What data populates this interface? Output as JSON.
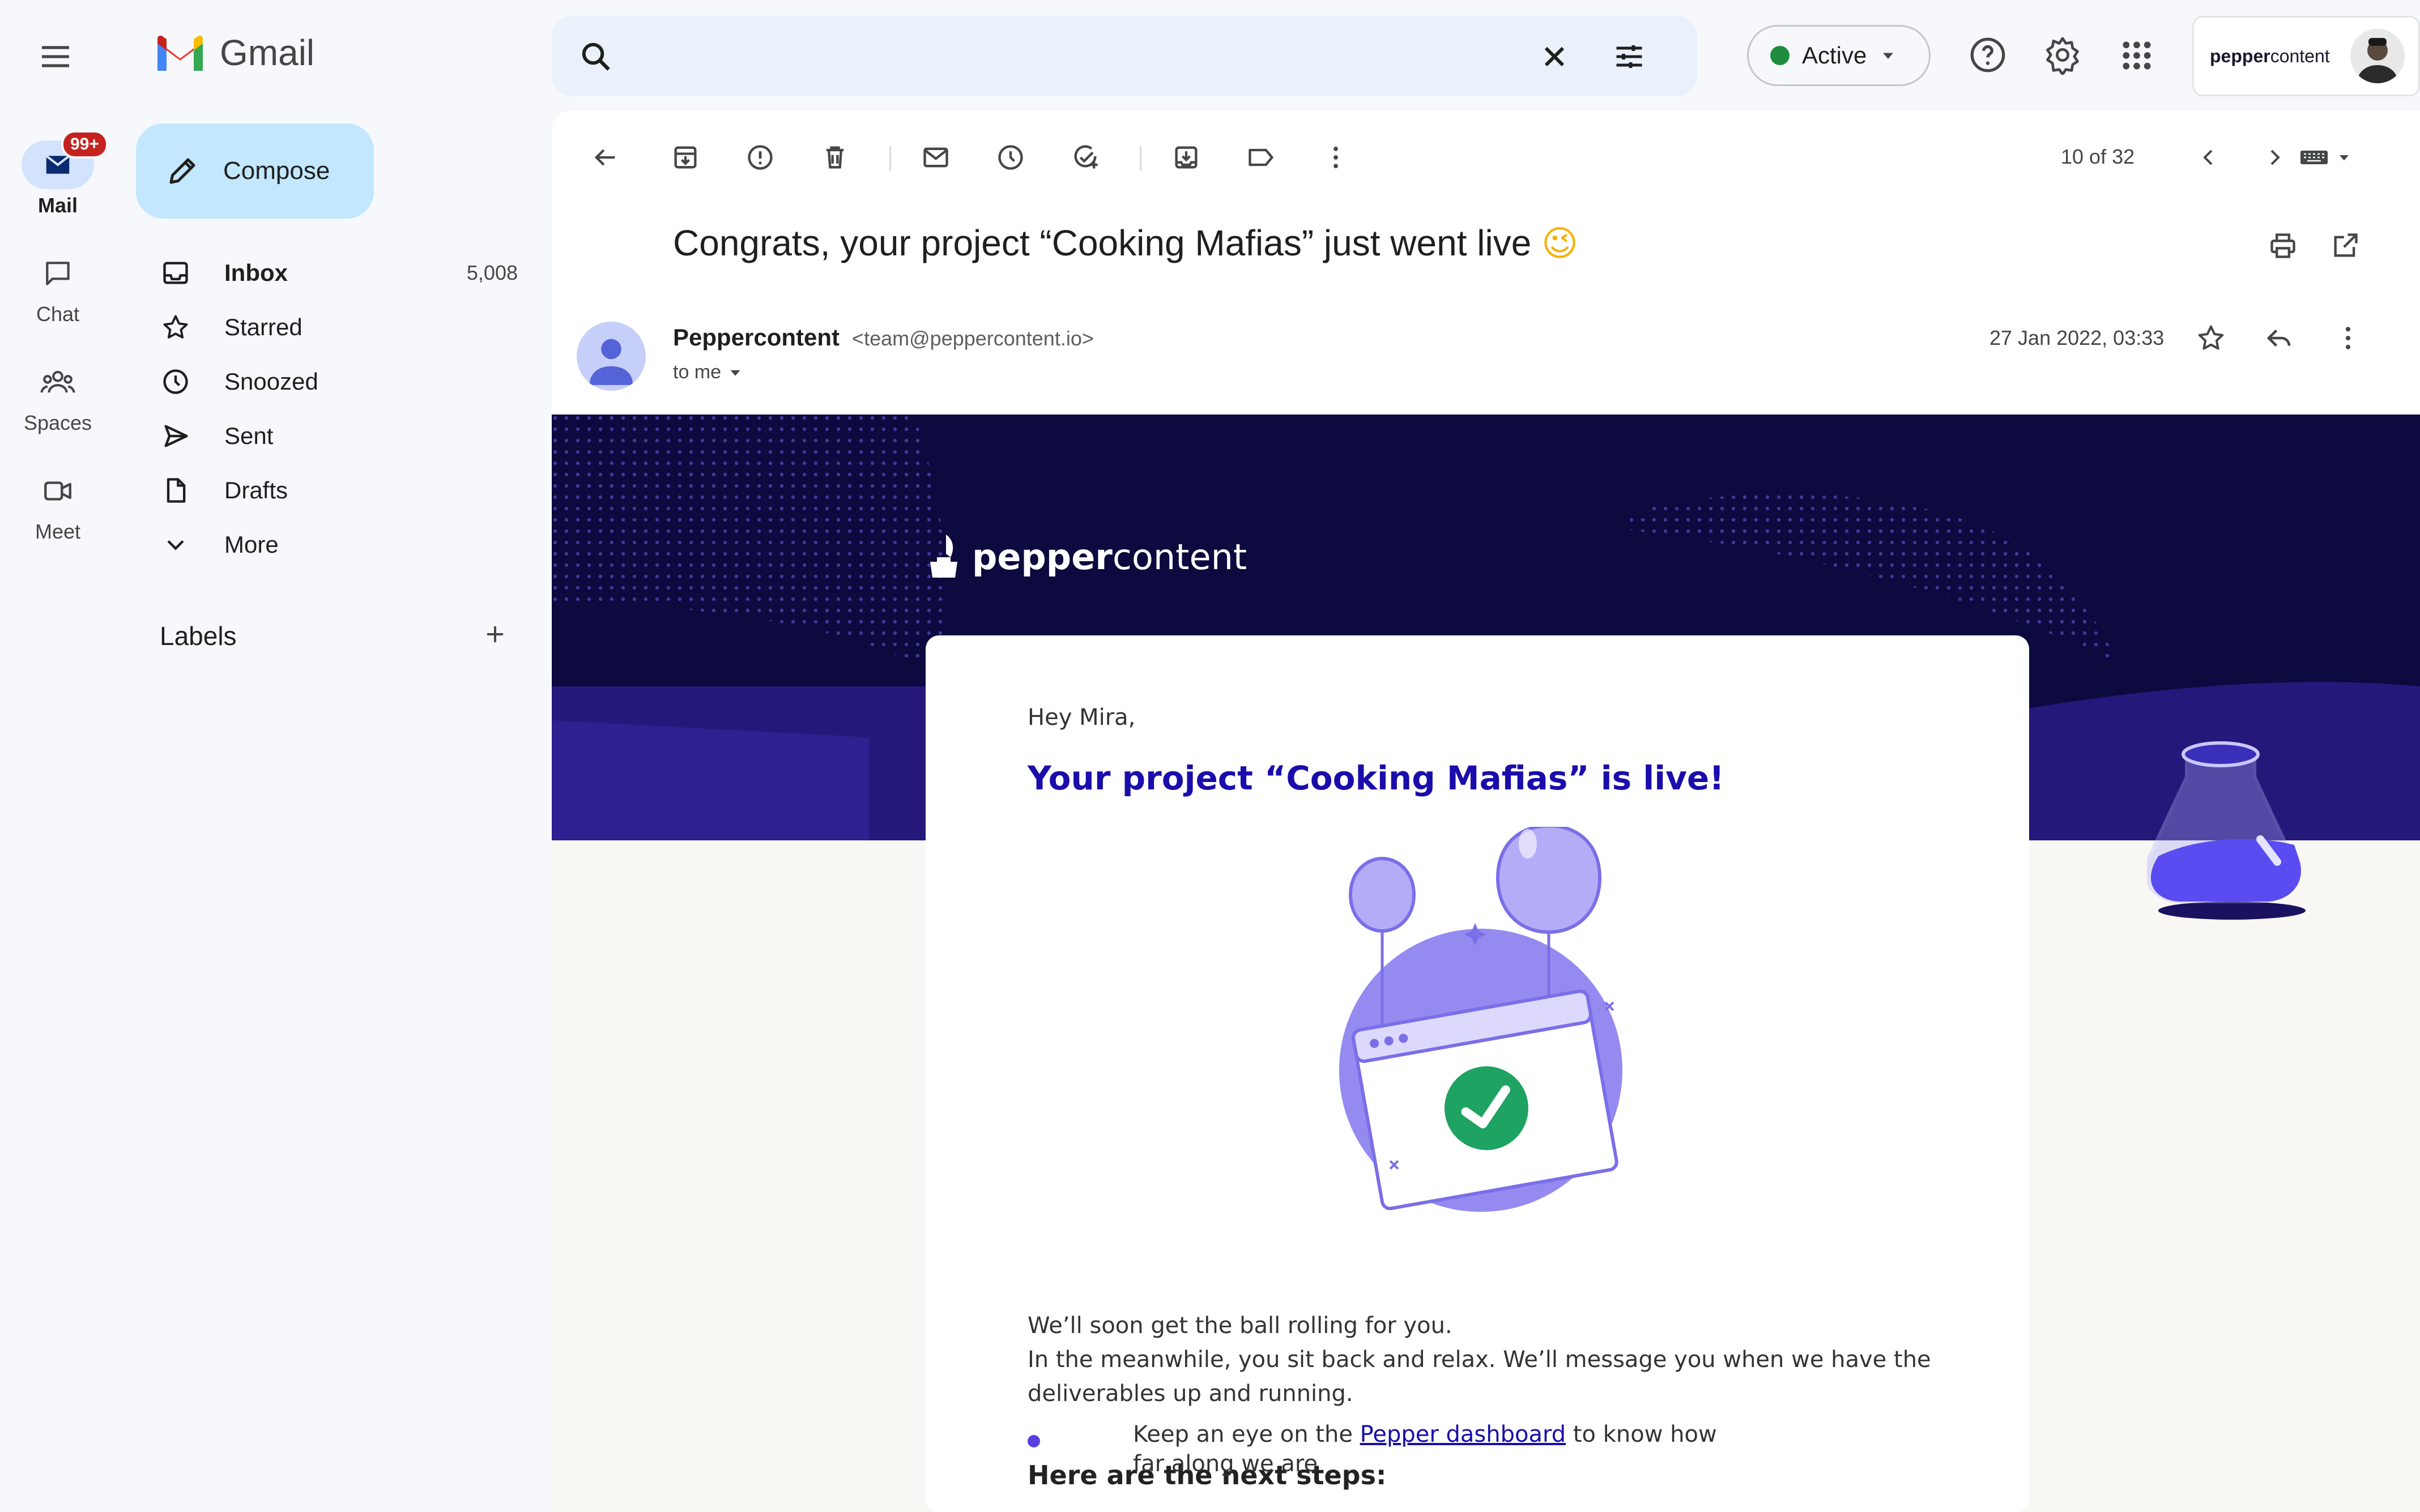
{
  "app": {
    "name": "Gmail"
  },
  "rail": {
    "items": [
      {
        "label": "Mail",
        "badge": "99+"
      },
      {
        "label": "Chat"
      },
      {
        "label": "Spaces"
      },
      {
        "label": "Meet"
      }
    ]
  },
  "sidebar": {
    "compose_label": "Compose",
    "items": [
      {
        "label": "Inbox",
        "count": "5,008"
      },
      {
        "label": "Starred"
      },
      {
        "label": "Snoozed"
      },
      {
        "label": "Sent"
      },
      {
        "label": "Drafts"
      },
      {
        "label": "More"
      }
    ],
    "labels_heading": "Labels"
  },
  "header": {
    "search_placeholder": "",
    "status_label": "Active",
    "status_color": "#1e8e3e",
    "account_brand_prefix": "pepper",
    "account_brand_suffix": "content"
  },
  "toolbar": {
    "pagination": "10 of 32",
    "icons": [
      "back-arrow-icon",
      "archive-icon",
      "report-spam-icon",
      "delete-icon",
      "mark-unread-icon",
      "snooze-icon",
      "add-task-icon",
      "move-to-icon",
      "label-icon",
      "more-vert-icon"
    ]
  },
  "message": {
    "subject": "Congrats, your project “Cooking Mafias” just went live",
    "subject_emoji": "😉",
    "sender_name": "Peppercontent",
    "sender_email": "<team@peppercontent.io>",
    "recipient": "to me",
    "date": "27 Jan 2022, 03:33"
  },
  "email_body": {
    "brand_bold": "pepper",
    "brand_light": "content",
    "greeting": "Hey Mira,",
    "headline": "Your project “Cooking Mafias” is live!",
    "para_line1": "We’ll soon get the ball rolling for you.",
    "para_line2": "In the meanwhile, you sit back and relax. We’ll message you when we have the",
    "para_line3": "deliverables up and running.",
    "steps_heading": "Here are the next steps:",
    "step1_pre": "Keep an eye on the ",
    "step1_link": "Pepper dashboard",
    "step1_post": " to know how",
    "step1_line2": "far along we are"
  },
  "colors": {
    "accent_blue": "#0b57d0",
    "compose_bg": "#c2e7ff",
    "banner_dark": "#0c0a3e",
    "headline_blue": "#1a0dab",
    "check_green": "#1ea362",
    "purple": "#8f85f0"
  }
}
